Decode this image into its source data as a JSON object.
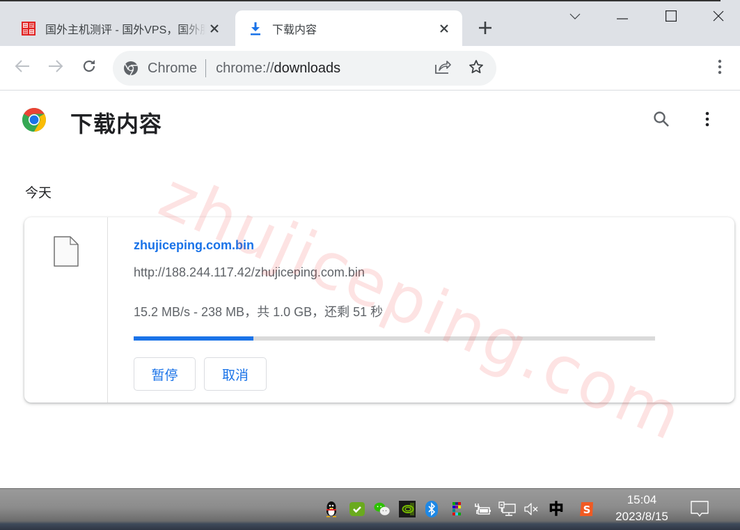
{
  "browser": {
    "tabs": [
      {
        "title": "国外主机测评 - 国外VPS，国外服务器",
        "favicon": "zhujiceping-seal-icon",
        "active": false
      },
      {
        "title": "下载内容",
        "favicon": "download-icon",
        "active": true
      }
    ],
    "new_tab_icon": "plus-icon",
    "window_controls": [
      "tab-search-icon",
      "minimize-icon",
      "maximize-icon",
      "close-icon"
    ],
    "toolbar": {
      "back_icon": "arrow-left-icon",
      "forward_icon": "arrow-right-icon",
      "reload_icon": "reload-icon",
      "omnibox": {
        "chip": "Chrome",
        "url_scheme": "chrome://",
        "url_host": "downloads"
      },
      "share_icon": "share-icon",
      "bookmark_icon": "star-icon",
      "menu_icon": "more-vert-icon"
    }
  },
  "page": {
    "title": "下载内容",
    "search_icon": "search-icon",
    "more_icon": "more-vert-icon",
    "date_group": "今天",
    "watermark": "zhujiceping.com",
    "downloads": [
      {
        "file_name": "zhujiceping.com.bin",
        "url": "http://188.244.117.42/zhujiceping.com.bin",
        "status": "15.2 MB/s - 238 MB，共 1.0 GB，还剩 51 秒",
        "progress_percent": 23,
        "buttons": {
          "pause": "暂停",
          "cancel": "取消"
        }
      }
    ]
  },
  "taskbar": {
    "tray_icons": [
      "qq-icon",
      "security-check-icon",
      "wechat-icon",
      "nvidia-icon",
      "bluetooth-icon",
      "color-grid-app-icon",
      "power-battery-icon",
      "network-icon",
      "volume-muted-icon",
      "ime-zhong-icon",
      "sogou-input-icon"
    ],
    "ime_label": "中",
    "time": "15:04",
    "date": "2023/8/15",
    "notification_icon": "notification-icon"
  },
  "colors": {
    "accent": "#1a73e8",
    "tabstrip_bg": "#dee1e6",
    "omnibox_bg": "#f1f3f4",
    "progress_track": "#dadada",
    "watermark": "#f05050"
  }
}
